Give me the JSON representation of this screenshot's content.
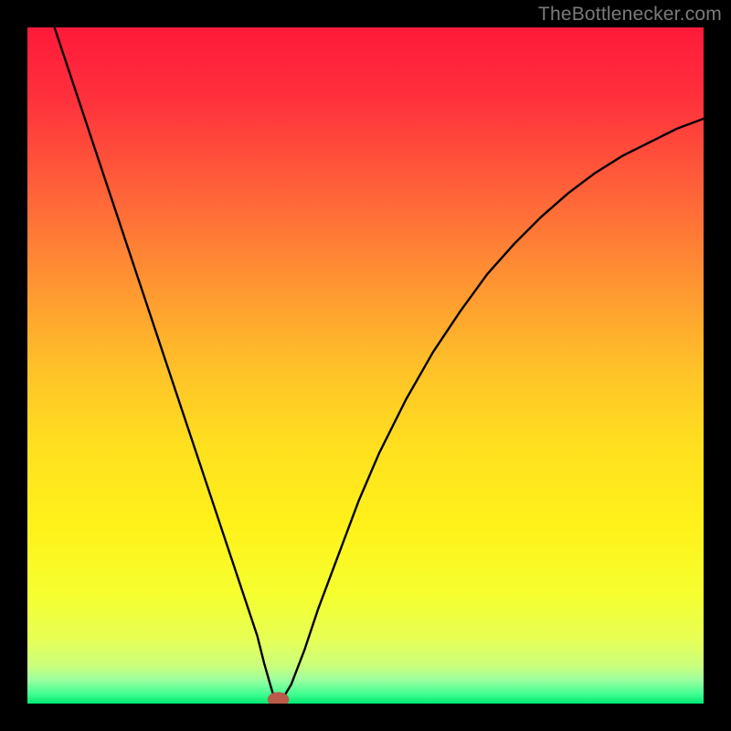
{
  "attribution": "TheBottleneсker.com",
  "chart_data": {
    "type": "line",
    "title": "",
    "xlabel": "",
    "ylabel": "",
    "xlim": [
      0,
      100
    ],
    "ylim": [
      0,
      100
    ],
    "grid": false,
    "legend": false,
    "gradient_stops": [
      {
        "offset": 0.0,
        "color": "#ff1a3a"
      },
      {
        "offset": 0.1,
        "color": "#ff2f3c"
      },
      {
        "offset": 0.22,
        "color": "#ff5a3a"
      },
      {
        "offset": 0.35,
        "color": "#ff8a34"
      },
      {
        "offset": 0.5,
        "color": "#ffc029"
      },
      {
        "offset": 0.62,
        "color": "#ffe01f"
      },
      {
        "offset": 0.74,
        "color": "#fff21a"
      },
      {
        "offset": 0.84,
        "color": "#f5ff30"
      },
      {
        "offset": 0.905,
        "color": "#e7ff55"
      },
      {
        "offset": 0.945,
        "color": "#c9ff7d"
      },
      {
        "offset": 0.965,
        "color": "#9cffa0"
      },
      {
        "offset": 0.985,
        "color": "#45ff93"
      },
      {
        "offset": 1.0,
        "color": "#00e873"
      }
    ],
    "series": [
      {
        "name": "bottleneck-curve",
        "color": "#000000",
        "width": 2.4,
        "x": [
          4,
          6,
          8,
          10,
          12,
          14,
          16,
          18,
          20,
          22,
          24,
          26,
          28,
          30,
          32,
          34,
          35,
          36,
          36.6,
          37.6,
          39,
          41,
          43,
          46,
          49,
          52,
          56,
          60,
          64,
          68,
          72,
          76,
          80,
          84,
          88,
          92,
          96,
          100
        ],
        "values": [
          100,
          94,
          88,
          82,
          76,
          70,
          64,
          58,
          52,
          46,
          40,
          34,
          28,
          22,
          16,
          10,
          6,
          2.5,
          0.5,
          0.5,
          2.8,
          8,
          14,
          22,
          30,
          37,
          45,
          52,
          58,
          63.5,
          68,
          72,
          75.5,
          78.5,
          81,
          83,
          85,
          86.5
        ]
      }
    ],
    "marker": {
      "x": 37.1,
      "y": 0.6,
      "rx": 1.6,
      "ry": 1.1,
      "color": "#b95a4a"
    }
  }
}
